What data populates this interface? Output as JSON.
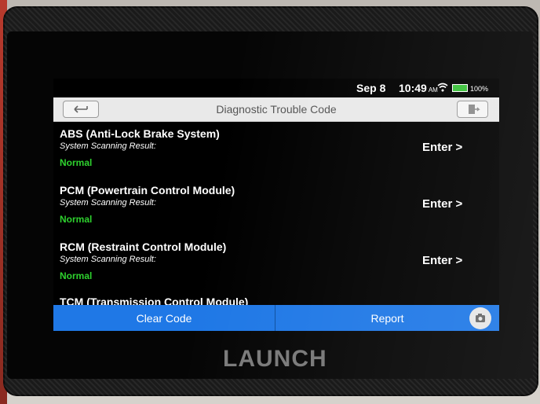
{
  "status": {
    "date": "Sep 8",
    "time": "10:49",
    "ampm": "AM",
    "battery": "100%"
  },
  "title": "Diagnostic Trouble Code",
  "systems": [
    {
      "name": "ABS (Anti-Lock Brake System)",
      "label": "System Scanning Result:",
      "status": "Normal",
      "action": "Enter >"
    },
    {
      "name": "PCM (Powertrain Control Module)",
      "label": "System Scanning Result:",
      "status": "Normal",
      "action": "Enter >"
    },
    {
      "name": "RCM (Restraint Control Module)",
      "label": "System Scanning Result:",
      "status": "Normal",
      "action": "Enter >"
    }
  ],
  "partial_item": "TCM (Transmission Control Module)",
  "bottom": {
    "clear": "Clear Code",
    "report": "Report"
  },
  "brand": "LAUNCH",
  "colors": {
    "accent": "#1f78e6",
    "normal": "#2ed12e"
  },
  "icons": [
    "wifi-icon",
    "battery-icon",
    "back-arrow-icon",
    "exit-icon",
    "camera-icon"
  ]
}
